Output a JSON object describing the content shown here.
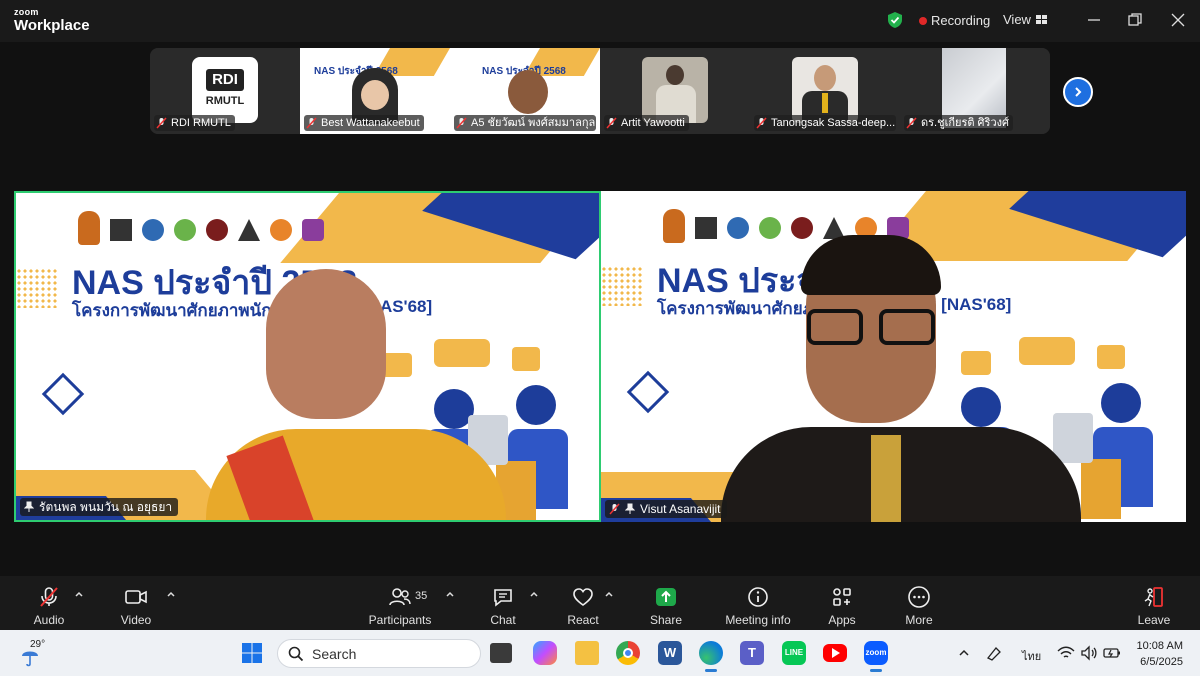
{
  "app": {
    "logo_small": "zoom",
    "logo_big": "Workplace",
    "recording_label": "Recording",
    "view_label": "View"
  },
  "thumbnails": [
    {
      "name": "RDI RMUTL",
      "logo_text": "RMUTL"
    },
    {
      "name": "Best Wattanakeebut",
      "slide_title": "NAS ประจำปี 2568"
    },
    {
      "name": "A5 ชัยวัฒน์ พงศ์สมมาลกุล",
      "slide_title": "NAS ประจำปี 2568"
    },
    {
      "name": "Artit Yawootti"
    },
    {
      "name": "Tanongsak Sassa-deep..."
    },
    {
      "name": "ดร.ชูเกียรติ ศิริวงศ์"
    }
  ],
  "main_videos": [
    {
      "name": "รัตนพล พนมวัน ณ อยุธยา",
      "slide_title": "NAS ประจำปี 2568",
      "slide_subtitle": "โครงการพัฒนาศักยภาพนักวิจัย",
      "slide_tag": "[NAS'68]"
    },
    {
      "name": "Visut Asanavijit",
      "slide_title": "NAS ประจำ",
      "slide_subtitle": "โครงการพัฒนาศักยภา",
      "slide_tag": "8 [NAS'68]"
    }
  ],
  "toolbar": {
    "audio": "Audio",
    "video": "Video",
    "participants": "Participants",
    "participants_count": "35",
    "chat": "Chat",
    "react": "React",
    "share": "Share",
    "meeting_info": "Meeting info",
    "apps": "Apps",
    "more": "More",
    "leave": "Leave"
  },
  "taskbar": {
    "temperature": "29°",
    "search_placeholder": "Search",
    "language": "ไทย",
    "time": "10:08 AM",
    "date": "6/5/2025"
  }
}
